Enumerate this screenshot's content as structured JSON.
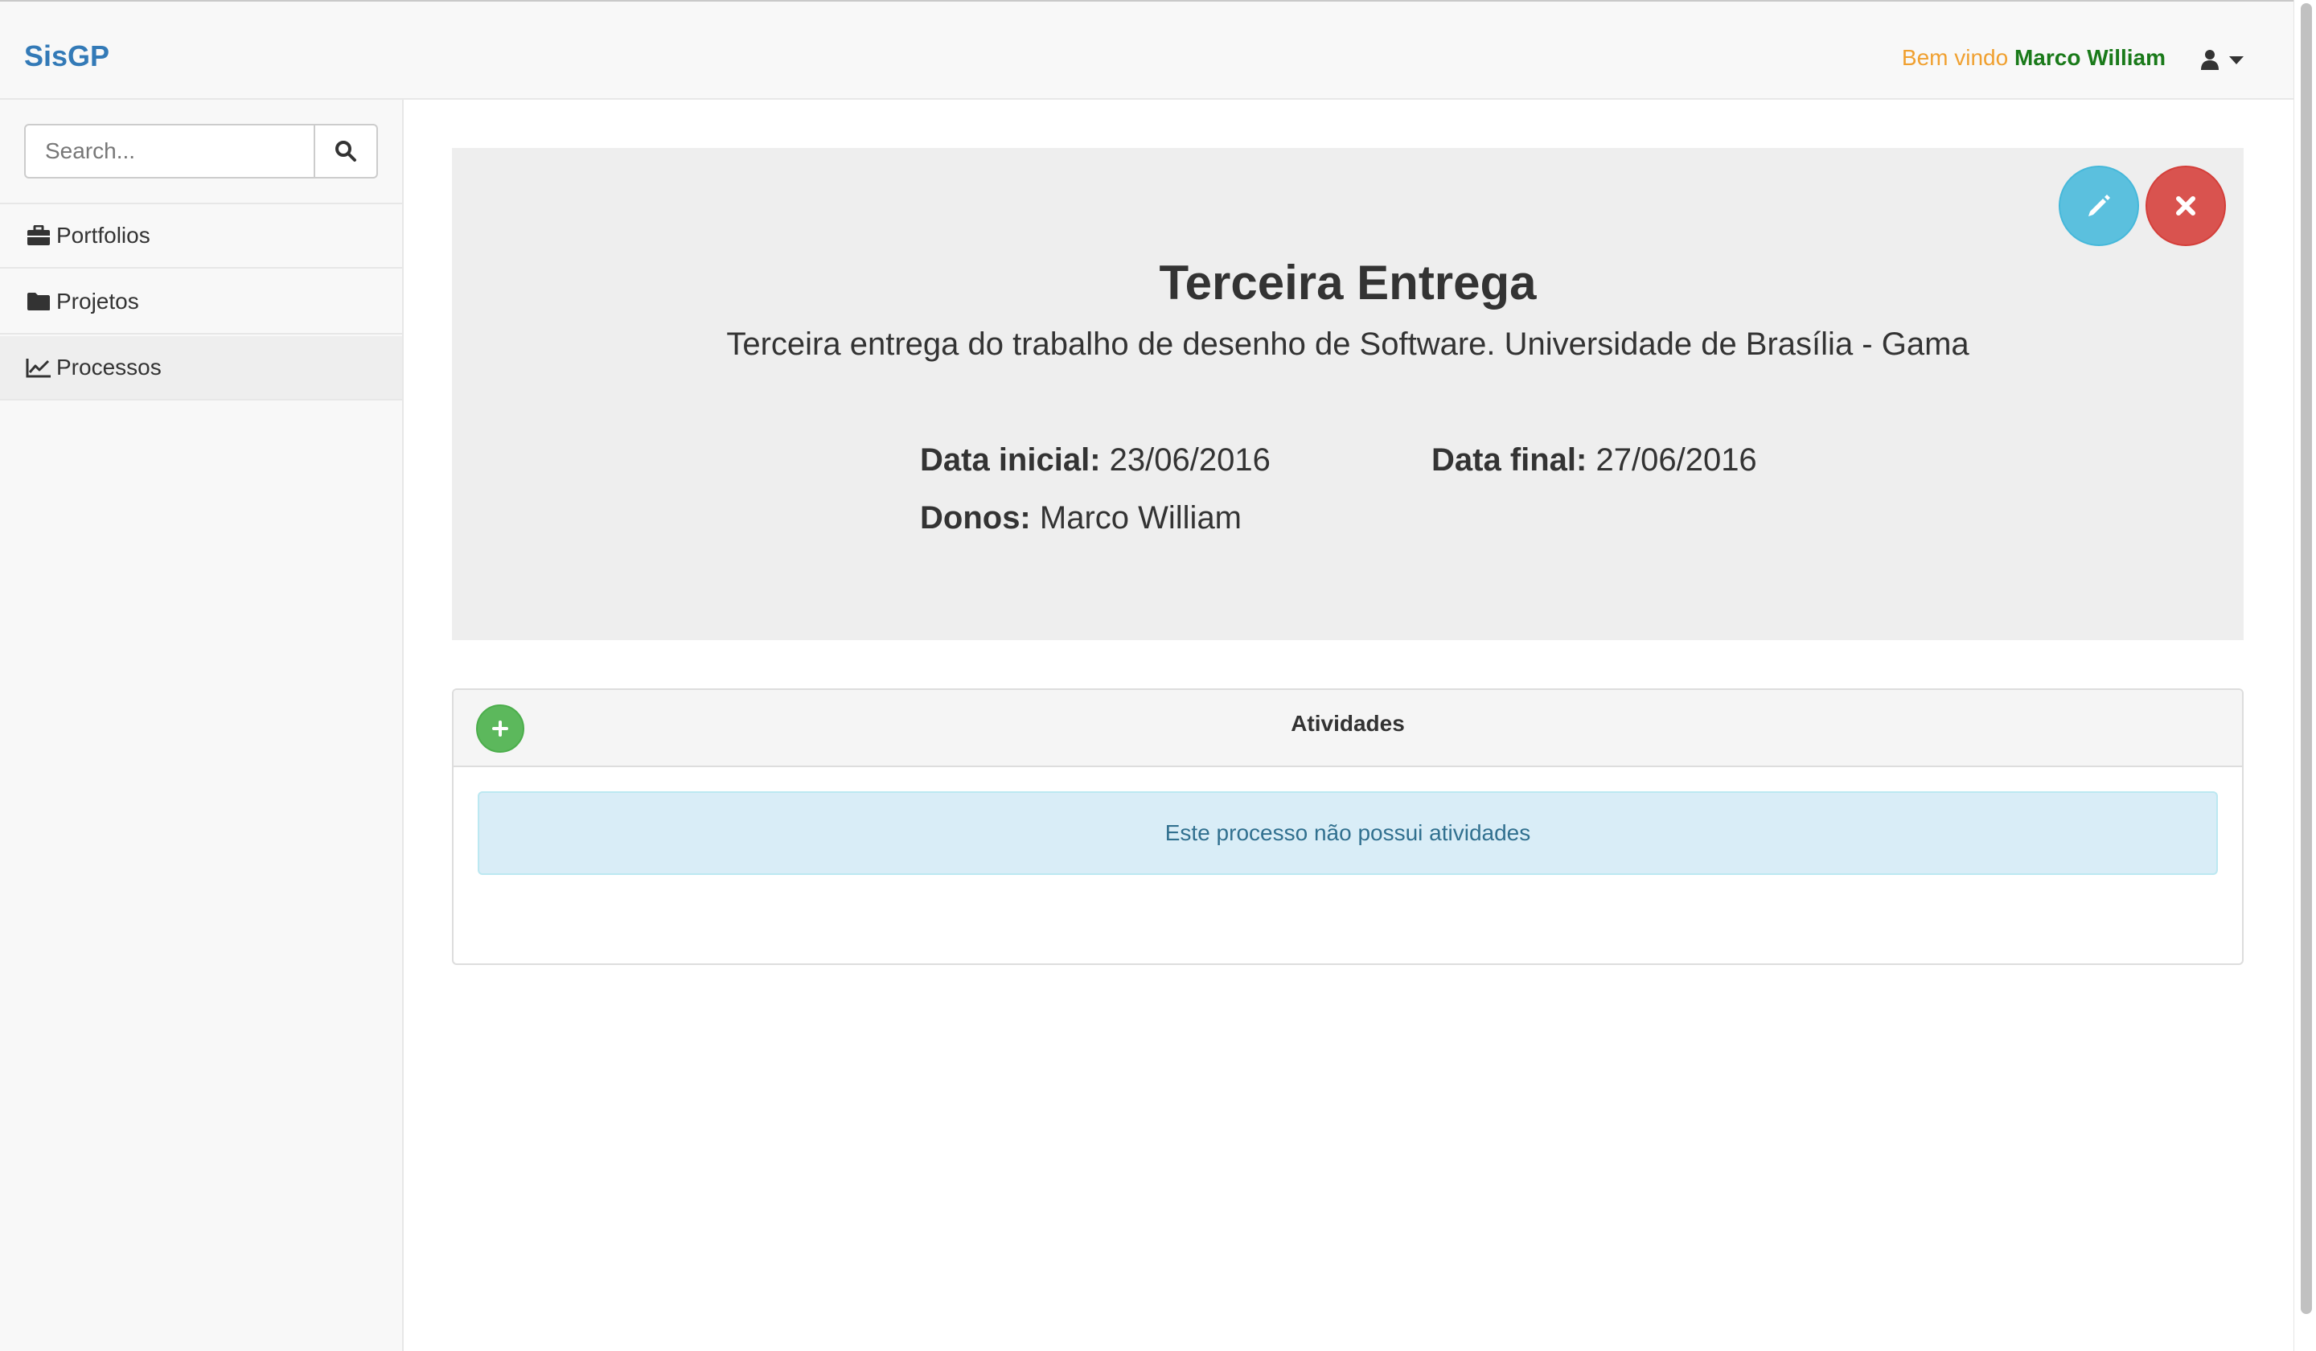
{
  "app": {
    "brand": "SisGP"
  },
  "header": {
    "welcome_prefix": "Bem vindo",
    "user_name": "Marco William",
    "user_menu_icon": "user-icon"
  },
  "sidebar": {
    "search": {
      "placeholder": "Search...",
      "value": ""
    },
    "items": [
      {
        "label": "Portfolios",
        "icon": "briefcase-icon",
        "active": false
      },
      {
        "label": "Projetos",
        "icon": "folder-icon",
        "active": false
      },
      {
        "label": "Processos",
        "icon": "line-chart-icon",
        "active": true
      }
    ]
  },
  "process": {
    "title": "Terceira Entrega",
    "description": "Terceira entrega do trabalho de desenho de Software. Universidade de Brasília - Gama",
    "start_label": "Data inicial:",
    "start_value": "23/06/2016",
    "end_label": "Data final:",
    "end_value": "27/06/2016",
    "owners_label": "Donos:",
    "owners_value": "Marco William"
  },
  "activities": {
    "title": "Atividades",
    "empty_message": "Este processo não possui atividades"
  },
  "colors": {
    "brand": "#337ab7",
    "welcome": "#f0a030",
    "user_name": "#1a7a1a",
    "edit": "#5bc0de",
    "delete": "#d9534f",
    "add": "#5cb85c",
    "info_bg": "#d9edf7",
    "info_text": "#31708f"
  }
}
